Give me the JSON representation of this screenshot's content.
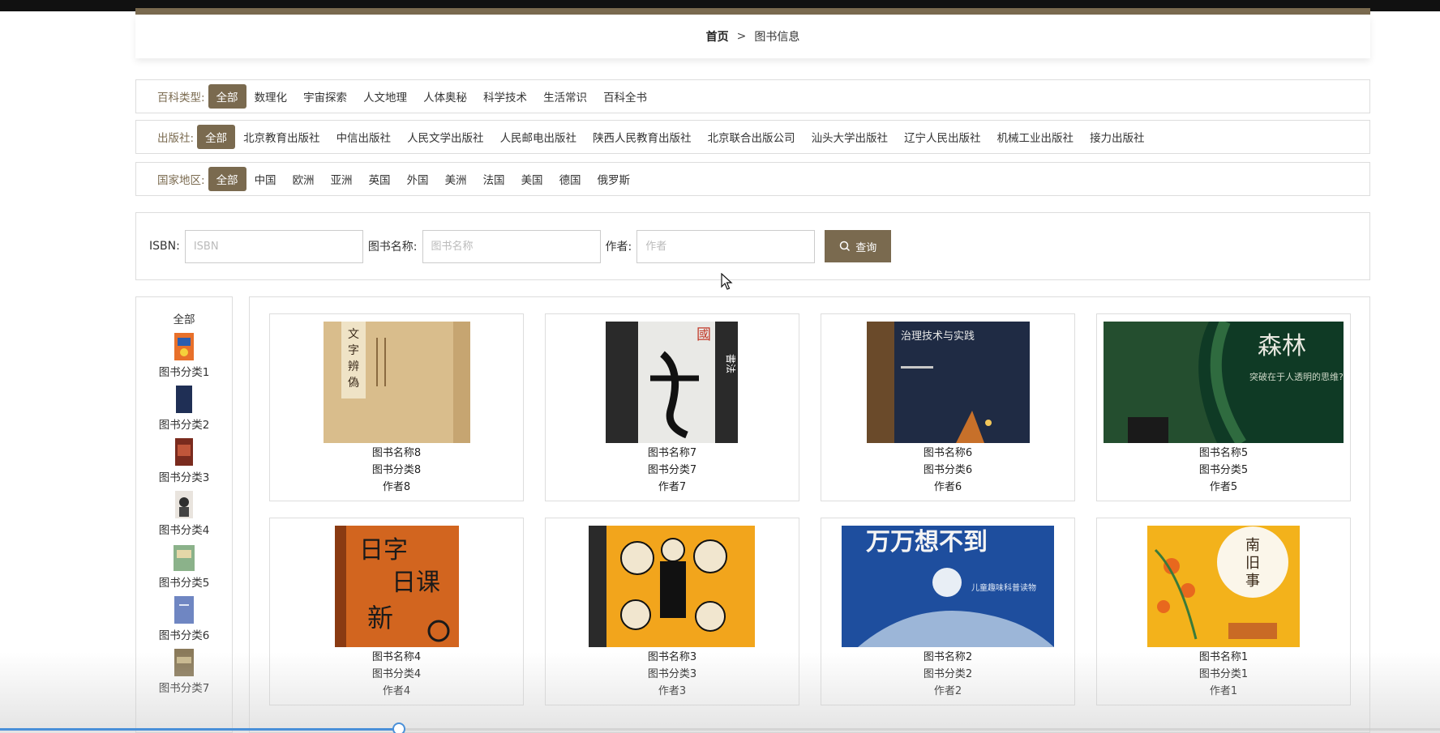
{
  "breadcrumb": {
    "home": "首页",
    "separator": ">",
    "current": "图书信息"
  },
  "filters": [
    {
      "label": "百科类型:",
      "options": [
        "全部",
        "数理化",
        "宇宙探索",
        "人文地理",
        "人体奥秘",
        "科学技术",
        "生活常识",
        "百科全书"
      ],
      "active": 0
    },
    {
      "label": "出版社:",
      "options": [
        "全部",
        "北京教育出版社",
        "中信出版社",
        "人民文学出版社",
        "人民邮电出版社",
        "陕西人民教育出版社",
        "北京联合出版公司",
        "汕头大学出版社",
        "辽宁人民出版社",
        "机械工业出版社",
        "接力出版社"
      ],
      "active": 0
    },
    {
      "label": "国家地区:",
      "options": [
        "全部",
        "中国",
        "欧洲",
        "亚洲",
        "英国",
        "外国",
        "美洲",
        "法国",
        "美国",
        "德国",
        "俄罗斯"
      ],
      "active": 0
    }
  ],
  "search": {
    "isbn_label": "ISBN:",
    "isbn_placeholder": "ISBN",
    "name_label": "图书名称:",
    "name_placeholder": "图书名称",
    "author_label": "作者:",
    "author_placeholder": "作者",
    "button_label": "查询"
  },
  "categories": {
    "all": "全部",
    "items": [
      "图书分类1",
      "图书分类2",
      "图书分类3",
      "图书分类4",
      "图书分类5",
      "图书分类6",
      "图书分类7"
    ]
  },
  "books": [
    {
      "name": "图书名称8",
      "category": "图书分类8",
      "author": "作者8",
      "cover_color": "#d9bd8c"
    },
    {
      "name": "图书名称7",
      "category": "图书分类7",
      "author": "作者7",
      "cover_color": "#2a2a2a",
      "cover_text": "書法"
    },
    {
      "name": "图书名称6",
      "category": "图书分类6",
      "author": "作者6",
      "cover_color": "#1f2b44",
      "cover_text": "治理技术与实践"
    },
    {
      "name": "图书名称5",
      "category": "图书分类5",
      "author": "作者5",
      "cover_color": "#0f3a25",
      "cover_text": "森林"
    },
    {
      "name": "图书名称4",
      "category": "图书分类4",
      "author": "作者4",
      "cover_color": "#d2651f",
      "cover_text": "日课新"
    },
    {
      "name": "图书名称3",
      "category": "图书分类3",
      "author": "作者3",
      "cover_color": "#f2a51c"
    },
    {
      "name": "图书名称2",
      "category": "图书分类2",
      "author": "作者2",
      "cover_color": "#1e4e9e",
      "cover_text": "万万想不到"
    },
    {
      "name": "图书名称1",
      "category": "图书分类1",
      "author": "作者1",
      "cover_color": "#f3b21b",
      "cover_text": "南旧事"
    }
  ],
  "video_progress": 0.277,
  "colors": {
    "accent": "#7a6a4f",
    "border": "#dddddd"
  }
}
